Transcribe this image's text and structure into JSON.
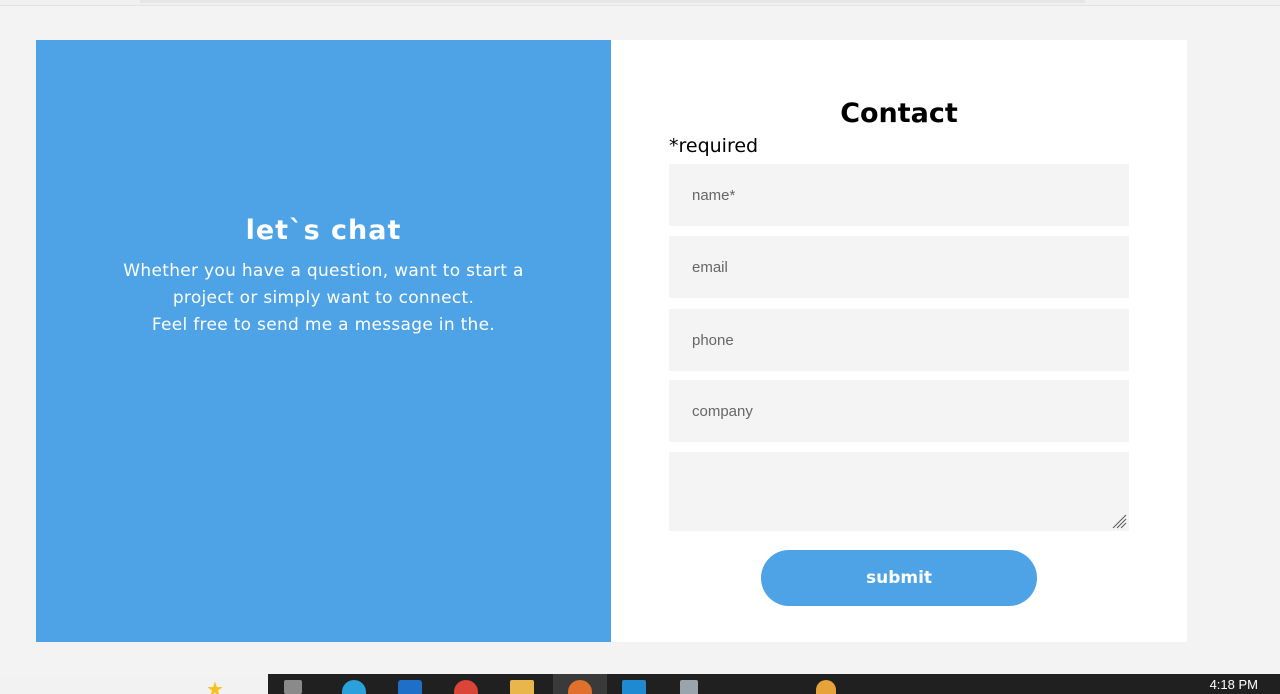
{
  "left_panel": {
    "title": "let`s chat",
    "lines": [
      "Whether you have a question, want to start a",
      "project or simply want to connect.",
      "Feel free to send me a message in the."
    ]
  },
  "form": {
    "title": "Contact",
    "required_note": "*required",
    "placeholders": {
      "name": "name*",
      "email": "email",
      "phone": "phone",
      "company": "company",
      "message": ""
    },
    "submit_label": "submit"
  },
  "taskbar": {
    "time": "4:18 PM"
  },
  "colors": {
    "accent": "#4da3e6",
    "field_bg": "#f4f4f4",
    "page_bg": "#f3f3f3",
    "taskbar_bg": "#202020"
  }
}
